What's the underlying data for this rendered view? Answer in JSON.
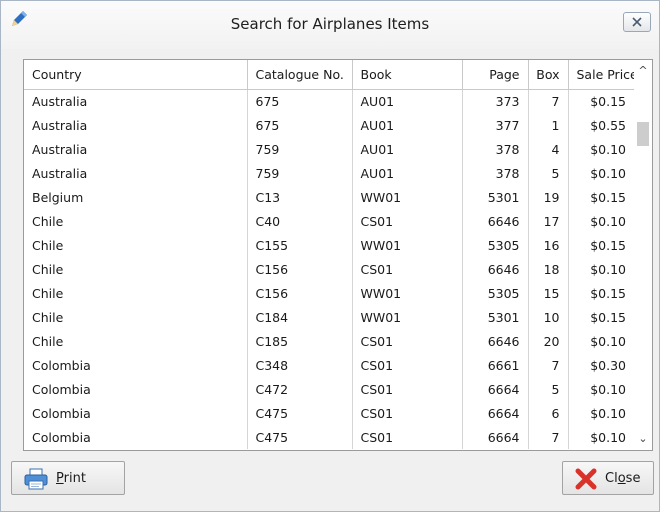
{
  "window": {
    "title": "Search for Airplanes Items"
  },
  "table": {
    "columns": [
      "Country",
      "Catalogue No.",
      "Book",
      "Page",
      "Box",
      "Sale Price"
    ],
    "rows": [
      [
        "Australia",
        "675",
        "AU01",
        "373",
        "7",
        "$0.15"
      ],
      [
        "Australia",
        "675",
        "AU01",
        "377",
        "1",
        "$0.55"
      ],
      [
        "Australia",
        "759",
        "AU01",
        "378",
        "4",
        "$0.10"
      ],
      [
        "Australia",
        "759",
        "AU01",
        "378",
        "5",
        "$0.10"
      ],
      [
        "Belgium",
        "C13",
        "WW01",
        "5301",
        "19",
        "$0.15"
      ],
      [
        "Chile",
        "C40",
        "CS01",
        "6646",
        "17",
        "$0.10"
      ],
      [
        "Chile",
        "C155",
        "WW01",
        "5305",
        "16",
        "$0.15"
      ],
      [
        "Chile",
        "C156",
        "CS01",
        "6646",
        "18",
        "$0.10"
      ],
      [
        "Chile",
        "C156",
        "WW01",
        "5305",
        "15",
        "$0.15"
      ],
      [
        "Chile",
        "C184",
        "WW01",
        "5301",
        "10",
        "$0.15"
      ],
      [
        "Chile",
        "C185",
        "CS01",
        "6646",
        "20",
        "$0.10"
      ],
      [
        "Colombia",
        "C348",
        "CS01",
        "6661",
        "7",
        "$0.30"
      ],
      [
        "Colombia",
        "C472",
        "CS01",
        "6664",
        "5",
        "$0.10"
      ],
      [
        "Colombia",
        "C475",
        "CS01",
        "6664",
        "6",
        "$0.10"
      ],
      [
        "Colombia",
        "C475",
        "CS01",
        "6664",
        "7",
        "$0.10"
      ]
    ]
  },
  "buttons": {
    "print": {
      "first": "P",
      "rest": "rint"
    },
    "close": {
      "first": "Cl",
      "mnemonic": "o",
      "rest": "se"
    }
  },
  "icons": {
    "app": "pencil-icon",
    "window_close": "close-icon",
    "scroll_up": "chevron-up-icon",
    "scroll_down": "chevron-down-icon",
    "print": "printer-icon",
    "close": "red-x-icon"
  },
  "colors": {
    "window_border": "#a9b6c6",
    "close_red": "#d9322a",
    "app_icon_blue": "#2f6fc2"
  }
}
